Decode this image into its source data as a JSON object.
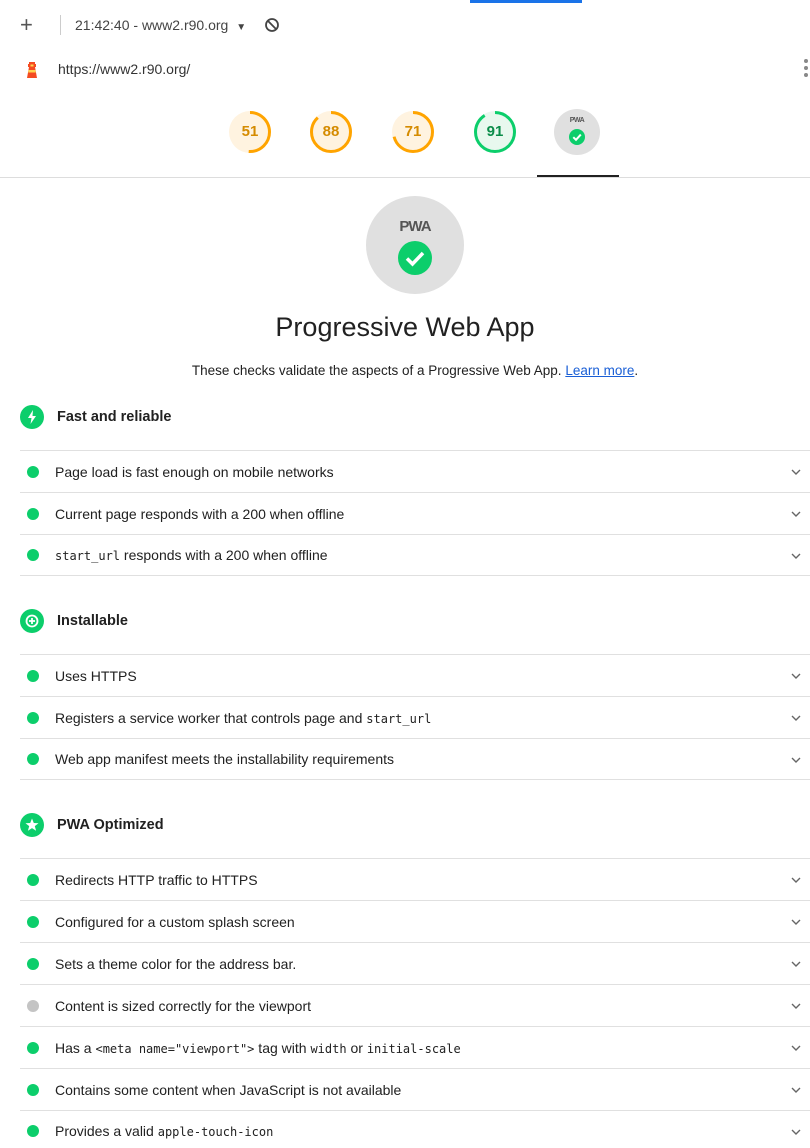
{
  "toolbar": {
    "add_label": "+",
    "report_label": "21:42:40 - www2.r90.org",
    "caret": "▼"
  },
  "urlbar": {
    "url": "https://www2.r90.org/"
  },
  "gauges": [
    {
      "score": "51",
      "value": 51,
      "color": "#ffa400",
      "bg": "#fff3e0",
      "name": "performance"
    },
    {
      "score": "88",
      "value": 88,
      "color": "#ffa400",
      "bg": "#fff3e0",
      "name": "accessibility"
    },
    {
      "score": "71",
      "value": 71,
      "color": "#ffa400",
      "bg": "#fff3e0",
      "name": "best-practices"
    },
    {
      "score": "91",
      "value": 91,
      "color": "#0cce6b",
      "bg": "#e8f8ee",
      "name": "seo"
    }
  ],
  "pwa_badge_text": "PWA",
  "section": {
    "title": "Progressive Web App",
    "description": "These checks validate the aspects of a Progressive Web App.",
    "learn_more": "Learn more",
    "period": "."
  },
  "colors": {
    "pass": "#0cce6b",
    "na": "#c4c4c4",
    "average": "#ffa400",
    "link": "#1a5fd6"
  },
  "groups": [
    {
      "title": "Fast and reliable",
      "icon": "lightning-icon",
      "audits": [
        {
          "parts": [
            {
              "t": "Page load is fast enough on mobile networks"
            }
          ],
          "status": "pass"
        },
        {
          "parts": [
            {
              "t": "Current page responds with a 200 when offline"
            }
          ],
          "status": "pass"
        },
        {
          "parts": [
            {
              "t": "start_url",
              "code": true
            },
            {
              "t": " responds with a 200 when offline"
            }
          ],
          "status": "pass"
        }
      ]
    },
    {
      "title": "Installable",
      "icon": "plus-icon",
      "audits": [
        {
          "parts": [
            {
              "t": "Uses HTTPS"
            }
          ],
          "status": "pass"
        },
        {
          "parts": [
            {
              "t": "Registers a service worker that controls page and "
            },
            {
              "t": "start_url",
              "code": true
            }
          ],
          "status": "pass"
        },
        {
          "parts": [
            {
              "t": "Web app manifest meets the installability requirements"
            }
          ],
          "status": "pass"
        }
      ]
    },
    {
      "title": "PWA Optimized",
      "icon": "star-icon",
      "audits": [
        {
          "parts": [
            {
              "t": "Redirects HTTP traffic to HTTPS"
            }
          ],
          "status": "pass"
        },
        {
          "parts": [
            {
              "t": "Configured for a custom splash screen"
            }
          ],
          "status": "pass"
        },
        {
          "parts": [
            {
              "t": "Sets a theme color for the address bar."
            }
          ],
          "status": "pass"
        },
        {
          "parts": [
            {
              "t": "Content is sized correctly for the viewport"
            }
          ],
          "status": "na"
        },
        {
          "parts": [
            {
              "t": "Has a "
            },
            {
              "t": "<meta name=\"viewport\">",
              "code": true
            },
            {
              "t": " tag with "
            },
            {
              "t": "width",
              "code": true
            },
            {
              "t": " or "
            },
            {
              "t": "initial-scale",
              "code": true
            }
          ],
          "status": "pass"
        },
        {
          "parts": [
            {
              "t": "Contains some content when JavaScript is not available"
            }
          ],
          "status": "pass"
        },
        {
          "parts": [
            {
              "t": "Provides a valid "
            },
            {
              "t": "apple-touch-icon",
              "code": true
            }
          ],
          "status": "pass"
        }
      ]
    }
  ]
}
